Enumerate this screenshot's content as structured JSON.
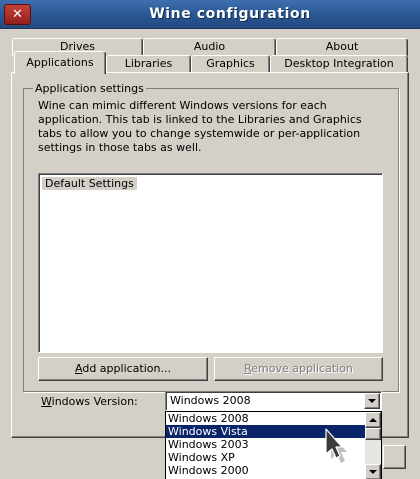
{
  "window": {
    "title": "Wine configuration",
    "close_glyph": "✕"
  },
  "tabs": {
    "back_row": [
      "Drives",
      "Audio",
      "About"
    ],
    "front_row": [
      "Applications",
      "Libraries",
      "Graphics",
      "Desktop Integration"
    ],
    "active": "Applications"
  },
  "app_settings": {
    "group_title": "Application settings",
    "description": "Wine can mimic different Windows versions for each application. This tab is linked to the Libraries and Graphics tabs to allow you to change systemwide or per-application settings in those tabs as well.",
    "list_items": [
      "Default Settings"
    ],
    "add_button": {
      "mnemonic": "A",
      "rest": "dd application..."
    },
    "remove_button": {
      "mnemonic": "R",
      "rest": "emove application",
      "enabled": false
    },
    "version_label": {
      "mnemonic": "W",
      "rest": "indows Version:"
    },
    "version_value": "Windows 2008",
    "version_options": [
      "Windows 2008",
      "Windows Vista",
      "Windows 2003",
      "Windows XP",
      "Windows 2000"
    ],
    "highlighted_option": "Windows Vista"
  },
  "icons": {
    "close": "close-icon",
    "combo_arrow": "chevron-down-icon",
    "scroll_up": "chevron-up-icon",
    "scroll_down": "chevron-down-icon",
    "cursor": "mouse-pointer-icon"
  },
  "colors": {
    "titlebar": "#2a5694",
    "selection": "#0a246a",
    "close_button": "#b0302b",
    "dialog_bg": "#d4d0c8"
  }
}
